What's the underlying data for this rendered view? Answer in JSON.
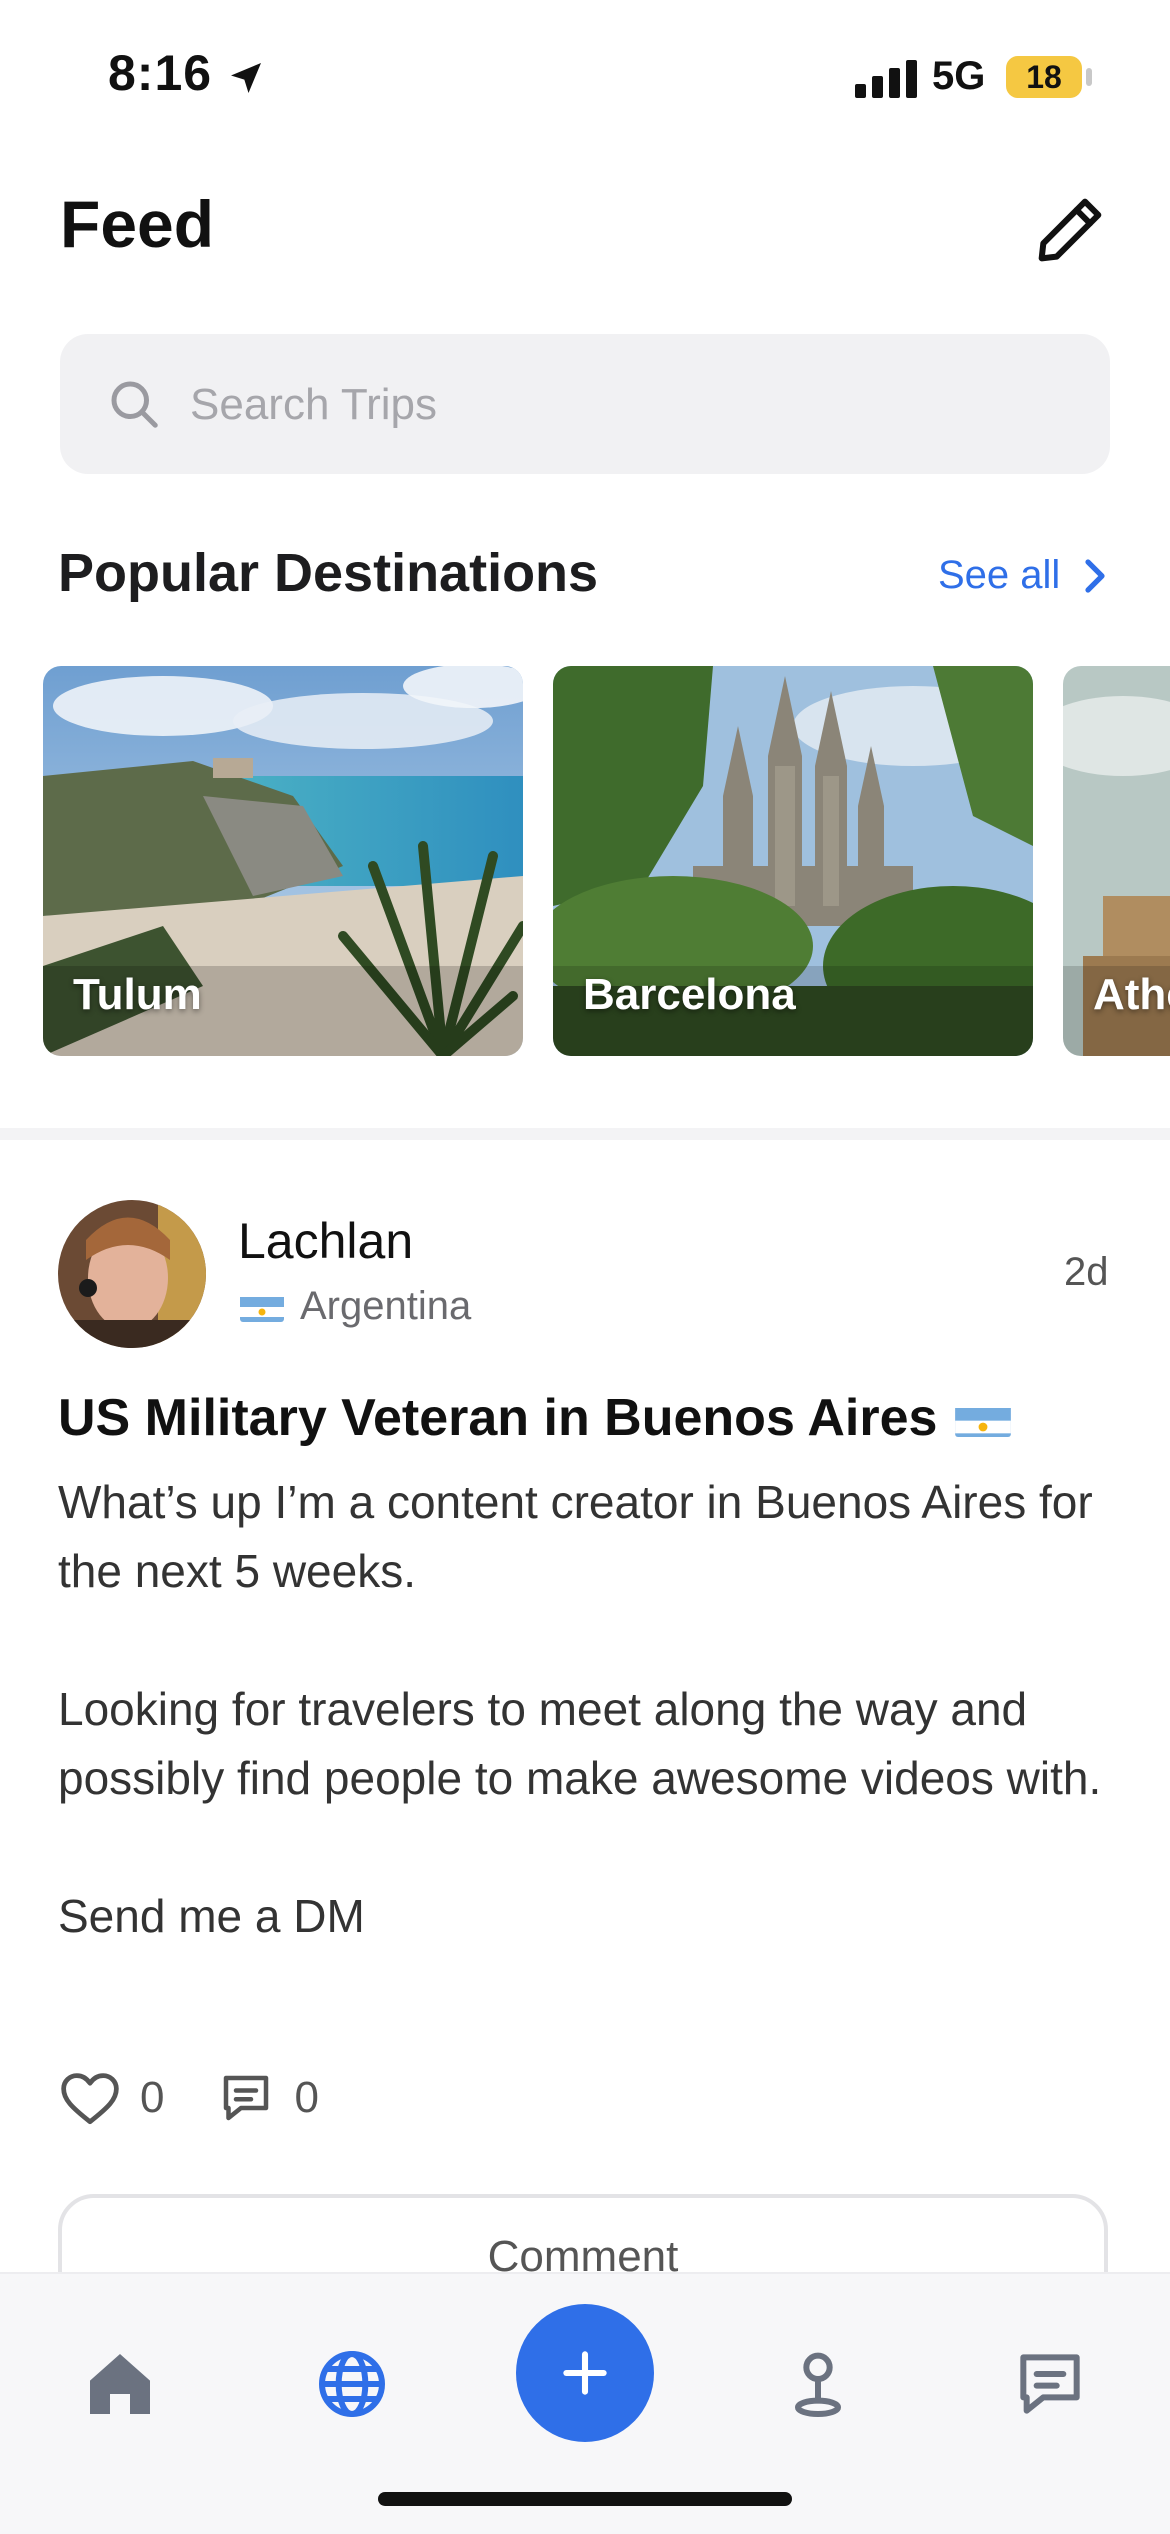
{
  "status_bar": {
    "time": "8:16",
    "network": "5G",
    "battery": "18"
  },
  "header": {
    "title": "Feed"
  },
  "search": {
    "placeholder": "Search Trips"
  },
  "popular": {
    "title": "Popular Destinations",
    "see_all": "See all",
    "destinations": [
      {
        "name": "Tulum"
      },
      {
        "name": "Barcelona"
      },
      {
        "name": "Athens"
      }
    ]
  },
  "post": {
    "author": "Lachlan",
    "location": "Argentina",
    "time_ago": "2d",
    "title": "US Military Veteran in Buenos Aires",
    "body": "What’s up I’m a content creator in Buenos Aires for the next 5 weeks.\n\nLooking for travelers to meet along the way and possibly find people to make awesome videos with.\n\nSend me a DM",
    "likes": "0",
    "comments": "0",
    "comment_button": "Comment"
  },
  "tabbar": {
    "items": [
      "home-icon",
      "globe-icon",
      "plus-icon",
      "map-pin-icon",
      "chat-icon"
    ],
    "active_color": "#2f6fe8",
    "inactive_color": "#6b7280"
  }
}
